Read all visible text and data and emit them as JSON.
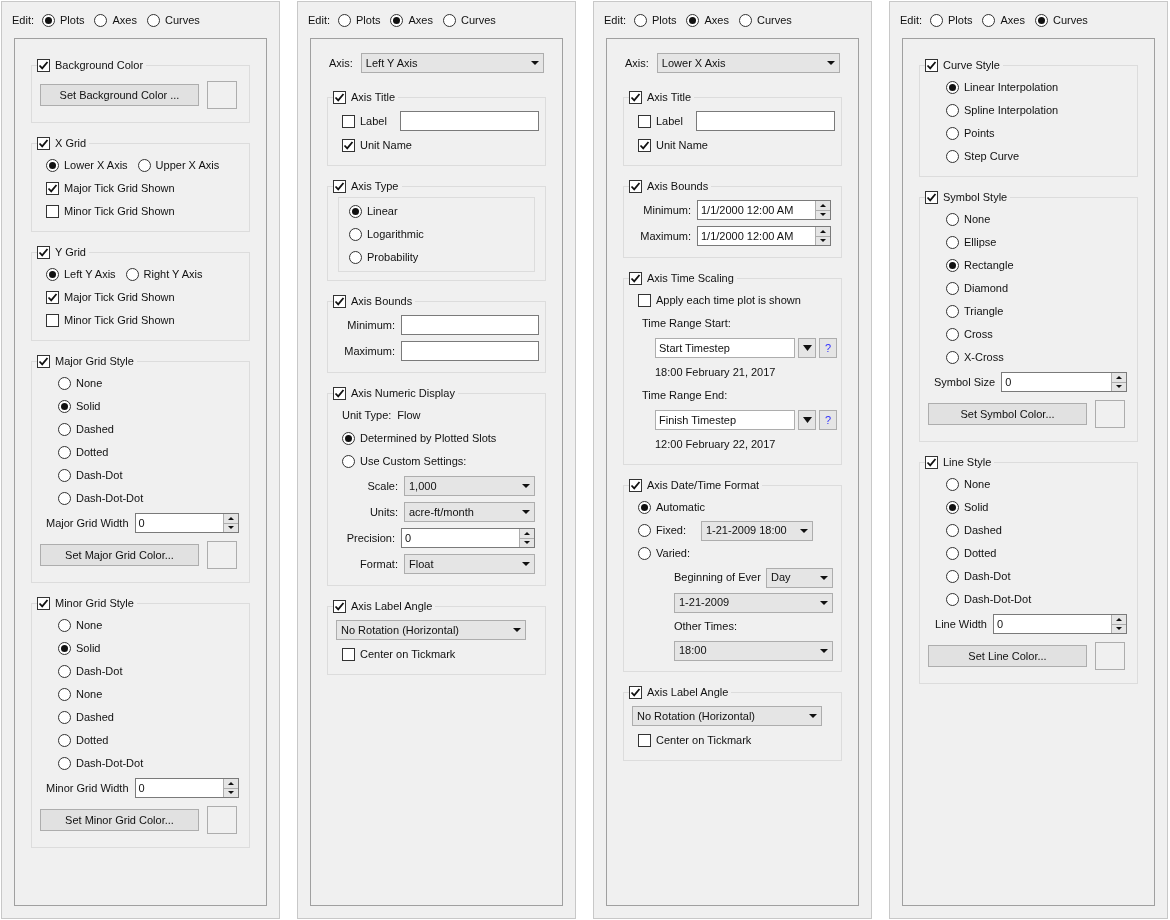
{
  "panels": [
    {
      "edit": {
        "label": "Edit:",
        "options": [
          {
            "label": "Plots",
            "selected": true
          },
          {
            "label": "Axes",
            "selected": false
          },
          {
            "label": "Curves",
            "selected": false
          }
        ]
      },
      "groups": [
        {
          "title": "Background Color",
          "checked": true,
          "items": [
            {
              "kind": "button",
              "label": "Set Background Color ..."
            }
          ]
        },
        {
          "title": "X Grid",
          "checked": true,
          "items": [
            {
              "kind": "radio_row",
              "options": [
                {
                  "label": "Lower X Axis",
                  "selected": true
                },
                {
                  "label": "Upper X Axis",
                  "selected": false
                }
              ]
            },
            {
              "kind": "checkbox",
              "label": "Major Tick Grid Shown",
              "checked": true
            },
            {
              "kind": "checkbox",
              "label": "Minor Tick Grid Shown",
              "checked": false
            }
          ]
        },
        {
          "title": "Y Grid",
          "checked": true,
          "items": [
            {
              "kind": "radio_row",
              "options": [
                {
                  "label": "Left Y Axis",
                  "selected": true
                },
                {
                  "label": "Right Y Axis",
                  "selected": false
                }
              ]
            },
            {
              "kind": "checkbox",
              "label": "Major Tick Grid Shown",
              "checked": true
            },
            {
              "kind": "checkbox",
              "label": "Minor Tick Grid Shown",
              "checked": false
            }
          ]
        },
        {
          "title": "Major Grid Style",
          "checked": true,
          "items": [
            {
              "kind": "radio",
              "label": "None",
              "selected": false
            },
            {
              "kind": "radio",
              "label": "Solid",
              "selected": true
            },
            {
              "kind": "radio",
              "label": "Dashed",
              "selected": false
            },
            {
              "kind": "radio",
              "label": "Dotted",
              "selected": false
            },
            {
              "kind": "radio",
              "label": "Dash-Dot",
              "selected": false
            },
            {
              "kind": "radio",
              "label": "Dash-Dot-Dot",
              "selected": false
            },
            {
              "kind": "spin",
              "label": "Major Grid Width",
              "value": "0"
            },
            {
              "kind": "button",
              "label": "Set Major Grid Color..."
            }
          ]
        },
        {
          "title": "Minor Grid Style",
          "checked": true,
          "items": [
            {
              "kind": "radio",
              "label": "None",
              "selected": false
            },
            {
              "kind": "radio",
              "label": "Solid",
              "selected": true
            },
            {
              "kind": "radio",
              "label": "Dash-Dot",
              "selected": false
            },
            {
              "kind": "radio",
              "label": "None",
              "selected": false
            },
            {
              "kind": "radio",
              "label": "Dashed",
              "selected": false
            },
            {
              "kind": "radio",
              "label": "Dotted",
              "selected": false
            },
            {
              "kind": "radio",
              "label": "Dash-Dot-Dot",
              "selected": false
            },
            {
              "kind": "spin",
              "label": "Minor Grid Width",
              "value": "0"
            },
            {
              "kind": "button",
              "label": "Set Minor Grid Color..."
            }
          ]
        }
      ]
    },
    {
      "edit": {
        "label": "Edit:",
        "options": [
          {
            "label": "Plots",
            "selected": false
          },
          {
            "label": "Axes",
            "selected": true
          },
          {
            "label": "Curves",
            "selected": false
          }
        ]
      },
      "axis": {
        "label": "Axis:",
        "value": "Left Y Axis"
      },
      "groups": [
        {
          "title": "Axis Title",
          "checked": true,
          "items": [
            {
              "kind": "checkbox_field",
              "label": "Label",
              "checked": false
            },
            {
              "kind": "checkbox",
              "label": "Unit Name",
              "checked": true
            }
          ]
        },
        {
          "title": "Axis Type",
          "checked": true,
          "items": [
            {
              "kind": "radio_box",
              "options": [
                {
                  "label": "Linear",
                  "selected": true
                },
                {
                  "label": "Logarithmic",
                  "selected": false
                },
                {
                  "label": "Probability",
                  "selected": false
                }
              ]
            }
          ]
        },
        {
          "title": "Axis Bounds",
          "checked": true,
          "items": [
            {
              "kind": "field",
              "label": "Minimum:"
            },
            {
              "kind": "field",
              "label": "Maximum:"
            }
          ]
        },
        {
          "title": "Axis Numeric Display",
          "checked": true,
          "items": [
            {
              "kind": "pair",
              "label": "Unit Type:",
              "value": "Flow"
            },
            {
              "kind": "radio",
              "label": "Determined by Plotted Slots",
              "selected": true
            },
            {
              "kind": "radio",
              "label": "Use Custom Settings:",
              "selected": false
            },
            {
              "kind": "combo",
              "label": "Scale:",
              "value": "1,000"
            },
            {
              "kind": "combo",
              "label": "Units:",
              "value": "acre-ft/month"
            },
            {
              "kind": "spin",
              "label": "Precision:",
              "value": "0"
            },
            {
              "kind": "combo",
              "label": "Format:",
              "value": "Float"
            }
          ]
        },
        {
          "title": "Axis Label Angle",
          "checked": true,
          "items": [
            {
              "kind": "combo",
              "value": "No Rotation (Horizontal)"
            },
            {
              "kind": "checkbox",
              "label": "Center on Tickmark",
              "checked": false
            }
          ]
        }
      ]
    },
    {
      "edit": {
        "label": "Edit:",
        "options": [
          {
            "label": "Plots",
            "selected": false
          },
          {
            "label": "Axes",
            "selected": true
          },
          {
            "label": "Curves",
            "selected": false
          }
        ]
      },
      "axis": {
        "label": "Axis:",
        "value": "Lower X Axis"
      },
      "groups": [
        {
          "title": "Axis Title",
          "checked": true,
          "items": [
            {
              "kind": "checkbox_field",
              "label": "Label",
              "checked": false
            },
            {
              "kind": "checkbox",
              "label": "Unit Name",
              "checked": true
            }
          ]
        },
        {
          "title": "Axis Bounds",
          "checked": true,
          "items": [
            {
              "kind": "spin",
              "label": "Minimum:",
              "value": "1/1/2000 12:00 AM"
            },
            {
              "kind": "spin",
              "label": "Maximum:",
              "value": "1/1/2000 12:00 AM"
            }
          ]
        },
        {
          "title": "Axis Time Scaling",
          "checked": true,
          "items": [
            {
              "kind": "checkbox",
              "label": "Apply each time plot is shown",
              "checked": false
            },
            {
              "kind": "text",
              "label": "Time Range Start:"
            },
            {
              "kind": "picker",
              "value": "Start Timestep",
              "help": "?"
            },
            {
              "kind": "note",
              "label": "18:00 February 21, 2017"
            },
            {
              "kind": "text",
              "label": "Time Range End:"
            },
            {
              "kind": "picker",
              "value": "Finish Timestep",
              "help": "?"
            },
            {
              "kind": "note",
              "label": "12:00 February 22, 2017"
            }
          ]
        },
        {
          "title": "Axis Date/Time Format",
          "checked": true,
          "items": [
            {
              "kind": "radio",
              "label": "Automatic",
              "selected": true
            },
            {
              "kind": "radio",
              "label": "Fixed:",
              "selected": false,
              "value": "1-21-2009 18:00"
            },
            {
              "kind": "radio",
              "label": "Varied:",
              "selected": false
            },
            {
              "kind": "subcombo",
              "label": "Beginning of Ever",
              "value": "Day"
            },
            {
              "kind": "subcombo",
              "value": "1-21-2009"
            },
            {
              "kind": "subtext",
              "label": "Other Times:"
            },
            {
              "kind": "subcombo",
              "value": "18:00"
            }
          ]
        },
        {
          "title": "Axis Label Angle",
          "checked": true,
          "items": [
            {
              "kind": "combo",
              "value": "No Rotation (Horizontal)"
            },
            {
              "kind": "checkbox",
              "label": "Center on Tickmark",
              "checked": false
            }
          ]
        }
      ]
    },
    {
      "edit": {
        "label": "Edit:",
        "options": [
          {
            "label": "Plots",
            "selected": false
          },
          {
            "label": "Axes",
            "selected": false
          },
          {
            "label": "Curves",
            "selected": true
          }
        ]
      },
      "groups": [
        {
          "title": "Curve Style",
          "checked": true,
          "items": [
            {
              "kind": "radio",
              "label": "Linear Interpolation",
              "selected": true
            },
            {
              "kind": "radio",
              "label": "Spline Interpolation",
              "selected": false
            },
            {
              "kind": "radio",
              "label": "Points",
              "selected": false
            },
            {
              "kind": "radio",
              "label": "Step Curve",
              "selected": false
            }
          ]
        },
        {
          "title": "Symbol Style",
          "checked": true,
          "items": [
            {
              "kind": "radio",
              "label": "None",
              "selected": false
            },
            {
              "kind": "radio",
              "label": "Ellipse",
              "selected": false
            },
            {
              "kind": "radio",
              "label": "Rectangle",
              "selected": true
            },
            {
              "kind": "radio",
              "label": "Diamond",
              "selected": false
            },
            {
              "kind": "radio",
              "label": "Triangle",
              "selected": false
            },
            {
              "kind": "radio",
              "label": "Cross",
              "selected": false
            },
            {
              "kind": "radio",
              "label": "X-Cross",
              "selected": false
            },
            {
              "kind": "spin",
              "label": "Symbol Size",
              "value": "0"
            },
            {
              "kind": "button",
              "label": "Set Symbol Color..."
            }
          ]
        },
        {
          "title": "Line Style",
          "checked": true,
          "items": [
            {
              "kind": "radio",
              "label": "None",
              "selected": false
            },
            {
              "kind": "radio",
              "label": "Solid",
              "selected": true
            },
            {
              "kind": "radio",
              "label": "Dashed",
              "selected": false
            },
            {
              "kind": "radio",
              "label": "Dotted",
              "selected": false
            },
            {
              "kind": "radio",
              "label": "Dash-Dot",
              "selected": false
            },
            {
              "kind": "radio",
              "label": "Dash-Dot-Dot",
              "selected": false
            },
            {
              "kind": "spin",
              "label": "Line Width",
              "value": "0"
            },
            {
              "kind": "button",
              "label": "Set Line Color..."
            }
          ]
        }
      ]
    }
  ]
}
